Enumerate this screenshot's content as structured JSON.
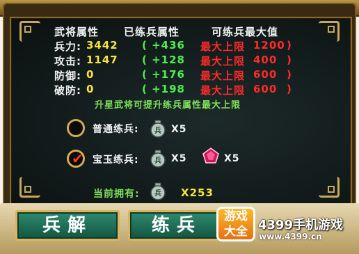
{
  "headers": {
    "general_attr": "武将属性",
    "trained_attr": "已练兵属性",
    "max_train": "可练兵最大值"
  },
  "stats": [
    {
      "label": "兵力:",
      "value": "3442",
      "bonus": "( +436",
      "limit_label": "最大上限",
      "limit": "1200",
      "close": ")"
    },
    {
      "label": "攻击:",
      "value": "1147",
      "bonus": "( +128",
      "limit_label": "最大上限",
      "limit": "400",
      "close": ")"
    },
    {
      "label": "防御:",
      "value": "0",
      "bonus": "( +176",
      "limit_label": "最大上限",
      "limit": "600",
      "close": ")"
    },
    {
      "label": "破防:",
      "value": "0",
      "bonus": "( +198",
      "limit_label": "最大上限",
      "limit": "600",
      "close": ")"
    }
  ],
  "tip": "升星武将可提升练兵属性最大上限",
  "options": {
    "normal": {
      "label": "普通练兵:",
      "cost": "X5",
      "selected": false
    },
    "gem": {
      "label": "宝玉练兵:",
      "cost": "X5",
      "gem_cost": "X5",
      "selected": true
    }
  },
  "owned": {
    "label": "当前拥有:",
    "count": "X253"
  },
  "medal_glyph": "兵",
  "buttons": {
    "disband": "兵解",
    "train": "练兵"
  },
  "watermark": {
    "logo_line1": "游戏",
    "logo_line2": "大全",
    "title": "4399手机游戏",
    "url": "www.4399.cn"
  },
  "colors": {
    "accent_gold": "#d9b45a",
    "value_yellow": "#f6e63a",
    "bonus_green": "#4df04d",
    "limit_red": "#ff2a2a"
  }
}
